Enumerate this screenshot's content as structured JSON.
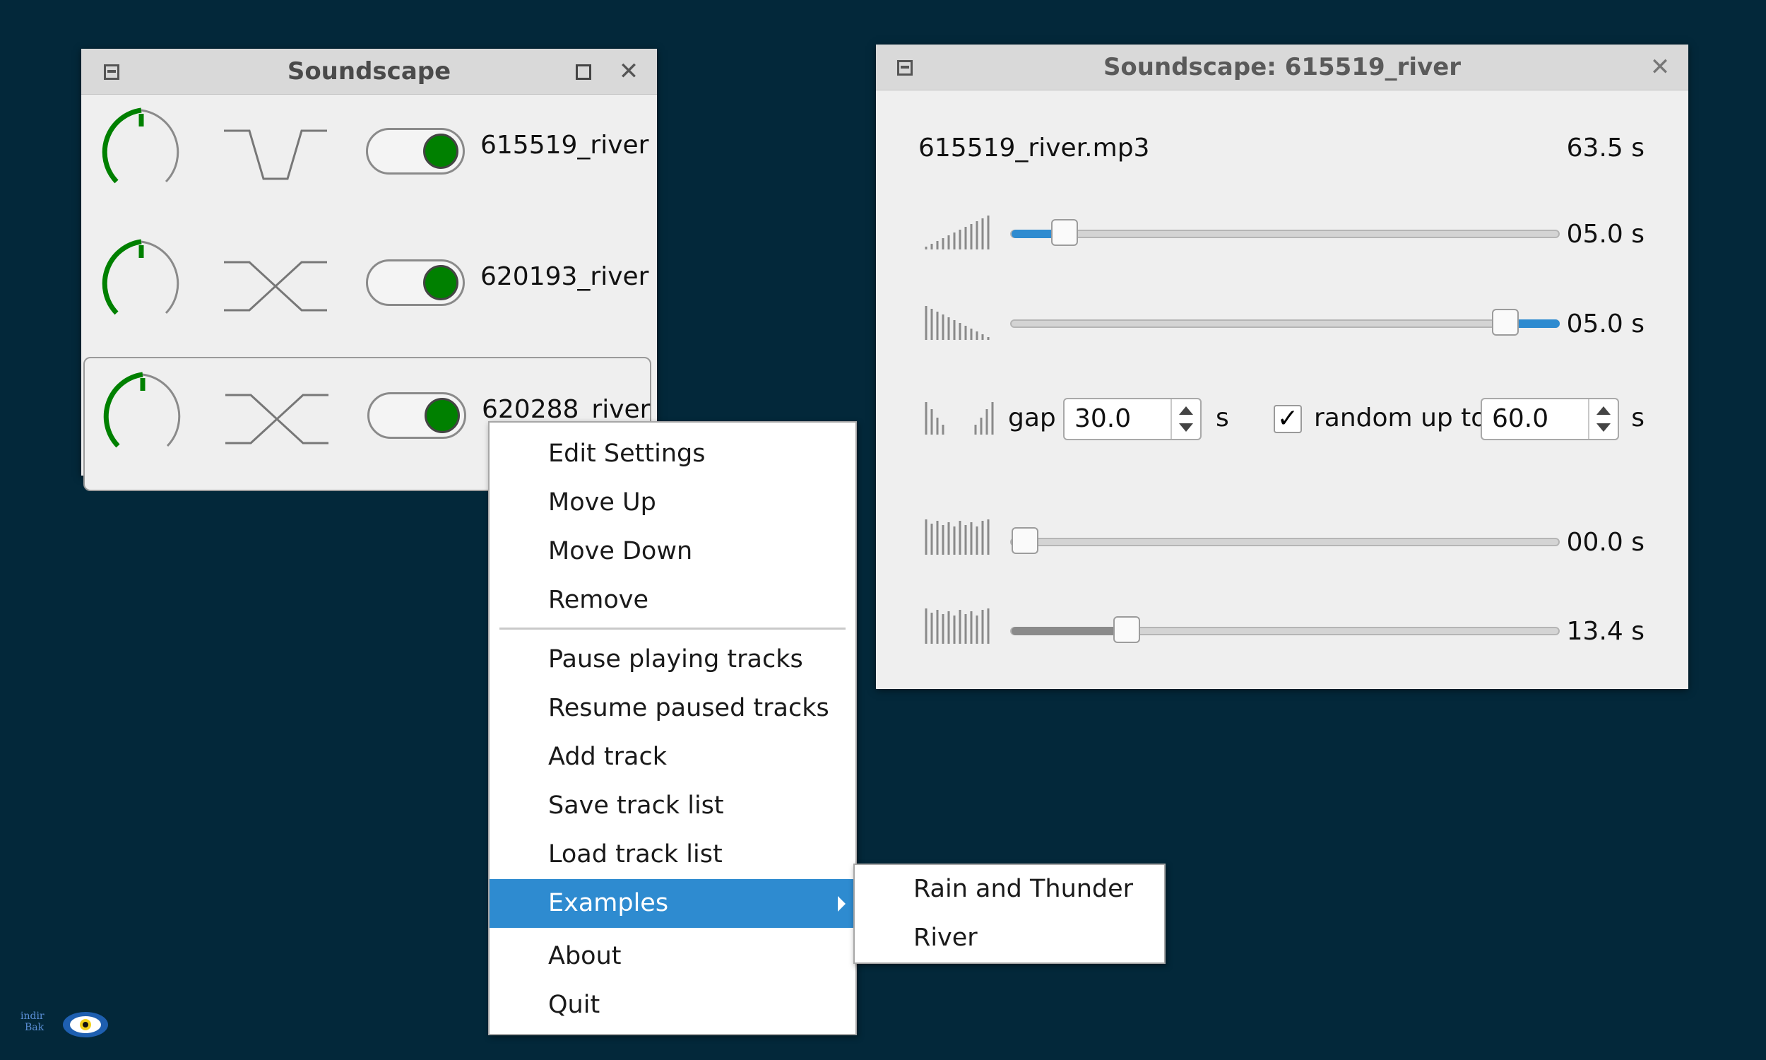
{
  "main_window": {
    "title": "Soundscape",
    "tracks": [
      {
        "name": "615519_river",
        "enabled": true,
        "curve": "fade-in-out"
      },
      {
        "name": "620193_river",
        "enabled": true,
        "curve": "crossfade"
      },
      {
        "name": "620288_river",
        "enabled": true,
        "curve": "crossfade",
        "selected": true
      }
    ]
  },
  "context_menu": {
    "items": [
      {
        "label": "Edit Settings"
      },
      {
        "label": "Move Up"
      },
      {
        "label": "Move Down"
      },
      {
        "label": "Remove"
      },
      {
        "separator": true
      },
      {
        "label": "Pause playing tracks"
      },
      {
        "label": "Resume paused tracks"
      },
      {
        "label": "Add track"
      },
      {
        "label": "Save track list"
      },
      {
        "label": "Load track list"
      },
      {
        "label": "Examples",
        "highlighted": true,
        "submenu": true
      },
      {
        "label": "About"
      },
      {
        "label": "Quit"
      }
    ],
    "submenu_items": [
      "Rain and Thunder",
      "River"
    ]
  },
  "settings_window": {
    "title": "Soundscape: 615519_river",
    "file_name": "615519_river.mp3",
    "duration": "63.5 s",
    "fade_in": {
      "value_label": "05.0 s",
      "fraction": 0.097
    },
    "fade_out": {
      "value_label": "05.0 s",
      "fraction": 0.903
    },
    "gap_label": "gap",
    "gap_value": "30.0",
    "gap_unit": "s",
    "random_checked": true,
    "random_label": "random up to",
    "random_value": "60.0",
    "random_unit": "s",
    "start_offset": {
      "value_label": "00.0 s",
      "fraction": 0.0
    },
    "play_length": {
      "value_label": "13.4 s",
      "fraction": 0.211
    }
  },
  "colors": {
    "background": "#03283a",
    "accent_blue": "#2e8bd0",
    "toggle_green": "#008000",
    "knob_green": "#008000"
  },
  "watermark": {
    "text_line1": "indir",
    "text_line2": "Bak"
  }
}
